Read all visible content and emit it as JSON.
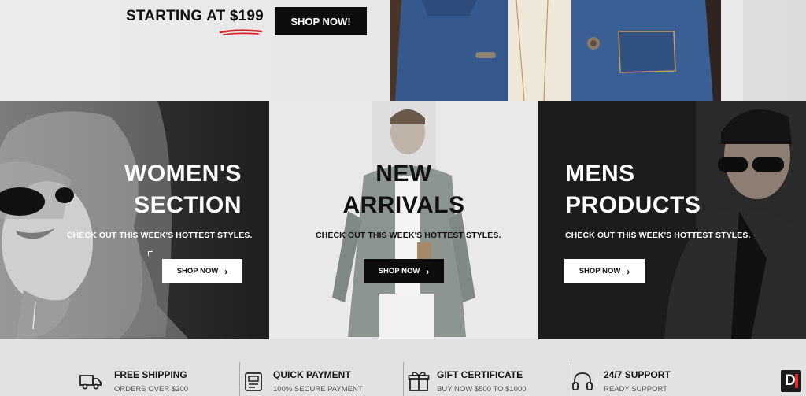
{
  "hero": {
    "promo_text": "STARTING AT ",
    "promo_price": "$199",
    "shop_label": "SHOP NOW!"
  },
  "panels": [
    {
      "title_line1": "WOMEN'S",
      "title_line2": "SECTION",
      "subtitle": "CHECK OUT THIS WEEK'S HOTTEST STYLES.",
      "button_label": "SHOP NOW"
    },
    {
      "title_line1": "NEW",
      "title_line2": "ARRIVALS",
      "subtitle": "CHECK OUT THIS WEEK'S HOTTEST STYLES.",
      "button_label": "SHOP NOW"
    },
    {
      "title_line1": "MENS",
      "title_line2": "PRODUCTS",
      "subtitle": "CHECK OUT THIS WEEK'S HOTTEST STYLES.",
      "button_label": "SHOP NOW"
    }
  ],
  "features": [
    {
      "title": "FREE SHIPPING",
      "desc": "ORDERS OVER $200",
      "icon": "truck-icon"
    },
    {
      "title": "QUICK PAYMENT",
      "desc": "100% SECURE PAYMENT",
      "icon": "payment-icon"
    },
    {
      "title": "GIFT CERTIFICATE",
      "desc": "BUY NOW $500 TO $1000",
      "icon": "gift-icon"
    },
    {
      "title": "24/7 SUPPORT",
      "desc": "READY SUPPORT",
      "icon": "headset-icon"
    }
  ],
  "brand": {
    "letter": "D"
  },
  "colors": {
    "accent_red": "#d9262b",
    "dark": "#0d0d0d",
    "light": "#ffffff"
  }
}
